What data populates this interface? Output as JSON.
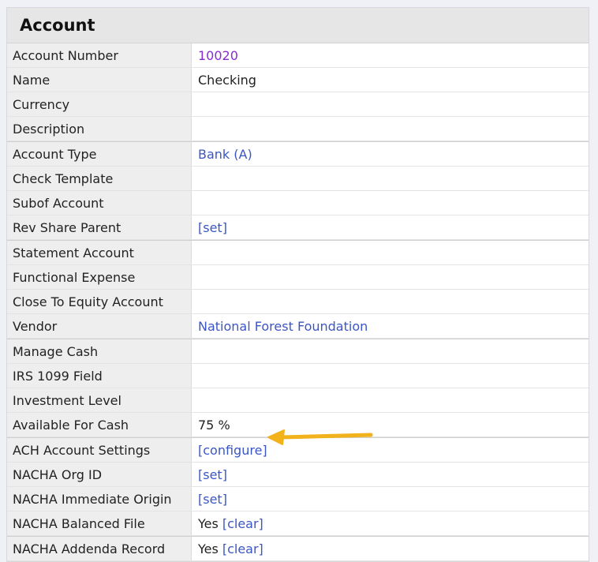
{
  "panel": {
    "title": "Account"
  },
  "rows": [
    {
      "label": "Account Number",
      "value": "10020"
    },
    {
      "label": "Name",
      "value": "Checking"
    },
    {
      "label": "Currency",
      "value": ""
    },
    {
      "label": "Description",
      "value": ""
    },
    {
      "label": "Account Type",
      "value": "Bank (A)"
    },
    {
      "label": "Check Template",
      "value": ""
    },
    {
      "label": "Subof Account",
      "value": ""
    },
    {
      "label": "Rev Share Parent",
      "value": "[set]"
    },
    {
      "label": "Statement Account",
      "value": ""
    },
    {
      "label": "Functional Expense",
      "value": ""
    },
    {
      "label": "Close To Equity Account",
      "value": ""
    },
    {
      "label": "Vendor",
      "value": "National Forest Foundation"
    },
    {
      "label": "Manage Cash",
      "value": ""
    },
    {
      "label": "IRS 1099 Field",
      "value": ""
    },
    {
      "label": "Investment Level",
      "value": ""
    },
    {
      "label": "Available For Cash",
      "value": "75 %"
    },
    {
      "label": "ACH Account Settings",
      "value": "[configure]"
    },
    {
      "label": "NACHA Org ID",
      "value": "[set]"
    },
    {
      "label": "NACHA Immediate Origin",
      "value": "[set]"
    },
    {
      "label": "NACHA Balanced File",
      "value": "Yes",
      "action": "[clear]"
    },
    {
      "label": "NACHA Addenda Record",
      "value": "Yes",
      "action": "[clear]"
    }
  ],
  "colors": {
    "link": "#3a56c6",
    "visited_link": "#8a2bd4",
    "arrow": "#f2b21b"
  }
}
